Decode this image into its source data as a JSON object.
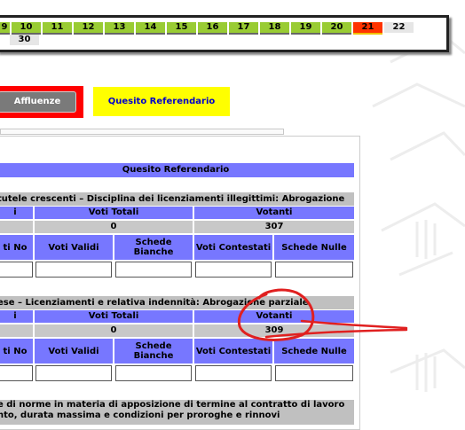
{
  "days": {
    "row1": [
      {
        "label": "9",
        "state": "green"
      },
      {
        "label": "10",
        "state": "green"
      },
      {
        "label": "11",
        "state": "green"
      },
      {
        "label": "12",
        "state": "green"
      },
      {
        "label": "13",
        "state": "green"
      },
      {
        "label": "14",
        "state": "green"
      },
      {
        "label": "15",
        "state": "green"
      },
      {
        "label": "16",
        "state": "green"
      },
      {
        "label": "17",
        "state": "green"
      },
      {
        "label": "18",
        "state": "green"
      },
      {
        "label": "19",
        "state": "green"
      },
      {
        "label": "20",
        "state": "green"
      },
      {
        "label": "21",
        "state": "selected"
      },
      {
        "label": "22",
        "state": "plain"
      }
    ],
    "row2": [
      {
        "label": "30",
        "state": "plain"
      }
    ]
  },
  "nav": {
    "affluenze": "Affluenze",
    "quesito": "Quesito Referendario"
  },
  "panel": {
    "header": "Quesito Referendario",
    "questions": [
      {
        "title": "tutele crescenti – Disciplina dei licenziamenti illegittimi: Abrogazione",
        "col_i": "i",
        "voti_totali_label": "Voti Totali",
        "votanti_label": "Votanti",
        "voti_totali": "0",
        "votanti": "307",
        "sub_headers": [
          "ti No",
          "Voti Validi",
          "Schede Bianche",
          "Voti Contestati",
          "Schede Nulle"
        ]
      },
      {
        "title": "ese – Licenziamenti e relativa indennità: Abrogazione parziale",
        "col_i": "i",
        "voti_totali_label": "Voti Totali",
        "votanti_label": "Votanti",
        "voti_totali": "0",
        "votanti": "309",
        "sub_headers": [
          "ti No",
          "Voti Validi",
          "Schede Bianche",
          "Voti Contestati",
          "Schede Nulle"
        ]
      },
      {
        "title_line1": "e di norme in materia di apposizione di termine al contratto di lavoro",
        "title_line2": "nto, durata massima e condizioni per proroghe e rinnovi"
      }
    ]
  },
  "colors": {
    "header_blue": "#7777ff",
    "title_grey": "#c0c0c0",
    "day_green": "#99cc33",
    "day_selected": "#ff3300",
    "quesito_yellow": "#ffff00",
    "affluenze_red_frame": "#ff0000",
    "annotation_red": "#e02020"
  }
}
